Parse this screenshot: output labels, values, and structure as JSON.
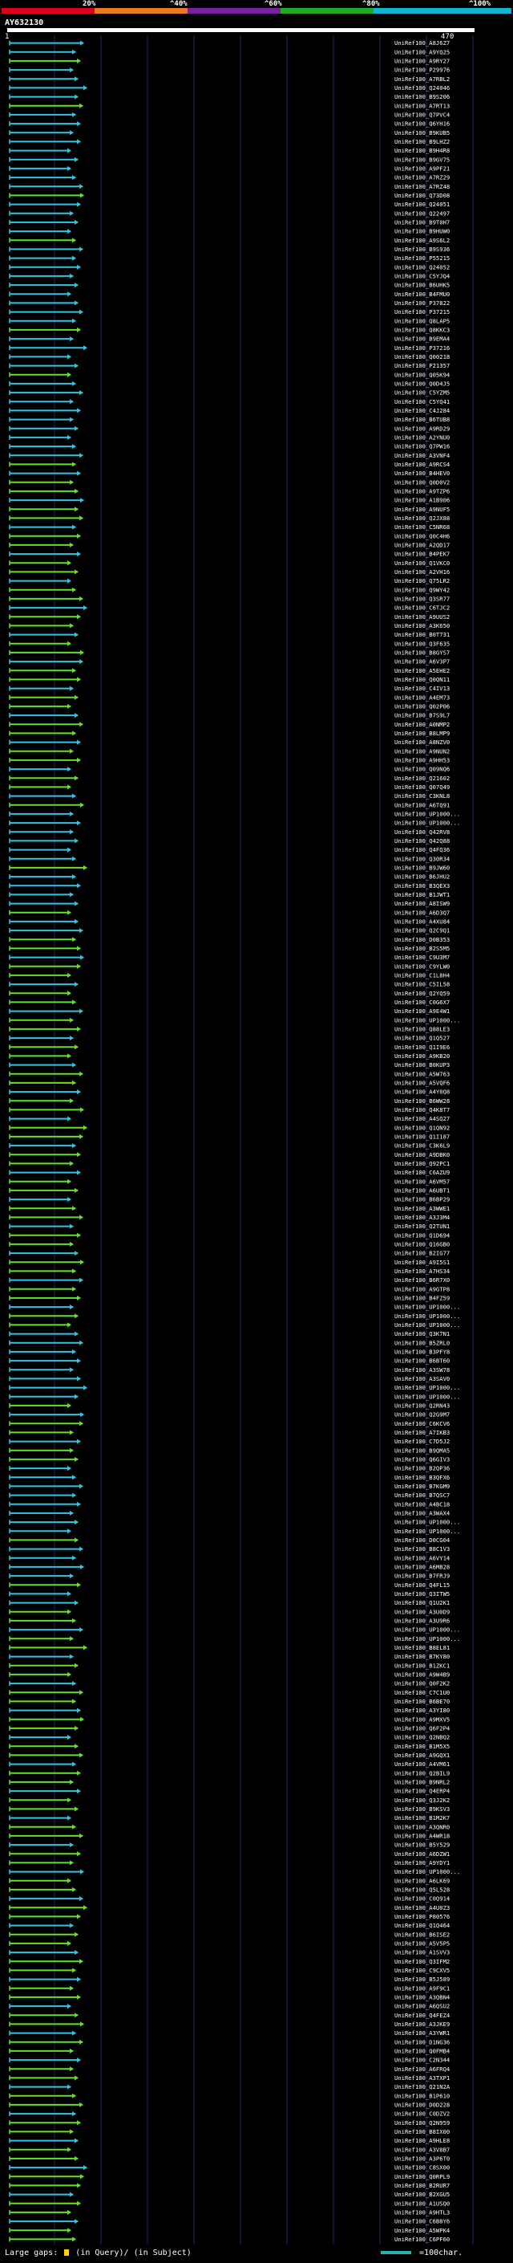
{
  "query": {
    "name": "AY632130",
    "start": "1",
    "end": "470"
  },
  "scale": {
    "labels": [
      "20%",
      "^40%",
      "^60%",
      "^80%",
      "^100%"
    ],
    "colors": [
      "#e0001a",
      "#e67a1c",
      "#7b1fa2",
      "#22aa22",
      "#10b5d6"
    ]
  },
  "colors": {
    "cyan": "#35c3e3",
    "green": "#66e02c",
    "grid_blue": "#1a2a66",
    "bg": "#000000"
  },
  "legend": {
    "left_text": "Large gaps:",
    "left_text2": "(in Query)/",
    "left_text3": "(in Subject)",
    "right_text": "=100char."
  },
  "hits": [
    "UniRef100_A8J6Z7",
    "UniRef100_A9YQ25",
    "UniRef100_A9RY27",
    "UniRef100_P29976",
    "UniRef100_A7RBL2",
    "UniRef100_Q24046",
    "UniRef100_B9S206",
    "UniRef100_A7RT13",
    "UniRef100_Q7PVC4",
    "UniRef100_Q6YH16",
    "UniRef100_B9KUB5",
    "UniRef100_B9LHZ2",
    "UniRef100_B9H4R8",
    "UniRef100_B9GV75",
    "UniRef100_A9PF21",
    "UniRef100_A7RZ29",
    "UniRef100_A7RZ48",
    "UniRef100_Q73D08",
    "UniRef100_Q24051",
    "UniRef100_Q22497",
    "UniRef100_B9T0H7",
    "UniRef100_B9HUW0",
    "UniRef100_A9S6L2",
    "UniRef100_B9S936",
    "UniRef100_P55215",
    "UniRef100_Q24052",
    "UniRef100_C5YJQ4",
    "UniRef100_B6UHK5",
    "UniRef100_B4FMU0",
    "UniRef100_P37822",
    "UniRef100_P37215",
    "UniRef100_Q8LAP5",
    "UniRef100_Q8KKC3",
    "UniRef100_B9EMA4",
    "UniRef100_P37216",
    "UniRef100_Q00218",
    "UniRef100_P21357",
    "UniRef100_Q05K94",
    "UniRef100_Q0D4J5",
    "UniRef100_C5YZM5",
    "UniRef100_C5YQ41",
    "UniRef100_C4J284",
    "UniRef100_B6TUB8",
    "UniRef100_A9RD29",
    "UniRef100_A2YNU0",
    "UniRef100_Q7PW16",
    "UniRef100_A3VNF4",
    "UniRef100_A9RCS4",
    "UniRef100_B4HEV0",
    "UniRef100_Q0D0V2",
    "UniRef100_A9TZP6",
    "UniRef100_A1B906",
    "UniRef100_A9NUF5",
    "UniRef100_Q2JX88",
    "UniRef100_C5NR68",
    "UniRef100_Q0C4H6",
    "UniRef100_A2QD17",
    "UniRef100_B4PEK7",
    "UniRef100_Q1VKC0",
    "UniRef100_A2VH16",
    "UniRef100_Q75LR2",
    "UniRef100_Q9WY42",
    "UniRef100_Q3SR77",
    "UniRef100_C6TJC2",
    "UniRef100_A9UUS2",
    "UniRef100_A3K650",
    "UniRef100_B0T731",
    "UniRef100_Q3F635",
    "UniRef100_B8GYS7",
    "UniRef100_A6V3P7",
    "UniRef100_A5EHE2",
    "UniRef100_Q0QN11",
    "UniRef100_C4IV13",
    "UniRef100_A4EM73",
    "UniRef100_Q02P06",
    "UniRef100_B7S9L7",
    "UniRef100_A0NMP2",
    "UniRef100_B8LMP9",
    "UniRef100_A8NZV0",
    "UniRef100_A9NUN2",
    "UniRef100_A9HH53",
    "UniRef100_Q09NQ6",
    "UniRef100_Q21602",
    "UniRef100_Q07Q49",
    "UniRef100_C3KNL8",
    "UniRef100_A6TQ91",
    "UniRef100_UP1000...",
    "UniRef100_UP1000...",
    "UniRef100_Q42RV8",
    "UniRef100_Q42Q88",
    "UniRef100_Q4FQ36",
    "UniRef100_Q30R34",
    "UniRef100_B9JW60",
    "UniRef100_B6JHU2",
    "UniRef100_B3QEX3",
    "UniRef100_B1JWT1",
    "UniRef100_A8ISW9",
    "UniRef100_A6D3Q7",
    "UniRef100_A4XU84",
    "UniRef100_Q2C9Q1",
    "UniRef100_D0B353",
    "UniRef100_B2S5M5",
    "UniRef100_C9U3M7",
    "UniRef100_C9YLW0",
    "UniRef100_C1L8H4",
    "UniRef100_C5IL58",
    "UniRef100_Q2YQ59",
    "UniRef100_C0G6X7",
    "UniRef100_A9E4W1",
    "UniRef100_UP1000...",
    "UniRef100_Q88LE3",
    "UniRef100_Q1Q527",
    "UniRef100_Q1I9E6",
    "UniRef100_A9KB20",
    "UniRef100_B0KUP3",
    "UniRef100_A5W763",
    "UniRef100_A5VQF6",
    "UniRef100_A4Y0Q8",
    "UniRef100_B6WW28",
    "UniRef100_Q4K8T7",
    "UniRef100_A4SQ27",
    "UniRef100_Q1QN92",
    "UniRef100_Q1I187",
    "UniRef100_C3K6L9",
    "UniRef100_A9DBK0",
    "UniRef100_Q92PC1",
    "UniRef100_C6AZU9",
    "UniRef100_A6VM57",
    "UniRef100_A6UBT1",
    "UniRef100_B6BP29",
    "UniRef100_A3WWE1",
    "UniRef100_A3J3M4",
    "UniRef100_Q2TUN1",
    "UniRef100_Q1D694",
    "UniRef100_Q16GB0",
    "UniRef100_B2IG77",
    "UniRef100_A9I5S1",
    "UniRef100_A7HS34",
    "UniRef100_B6R7X0",
    "UniRef100_A9GTP8",
    "UniRef100_B4FZ59",
    "UniRef100_UP1000...",
    "UniRef100_UP1000...",
    "UniRef100_UP1000...",
    "UniRef100_Q3K7N1",
    "UniRef100_B5ZRL0",
    "UniRef100_B3PFY8",
    "UniRef100_B6BT60",
    "UniRef100_A3SW78",
    "UniRef100_A3SAV0",
    "UniRef100_UP1000...",
    "UniRef100_UP1000...",
    "UniRef100_Q2RN43",
    "UniRef100_Q2G9M7",
    "UniRef100_C6KCV6",
    "UniRef100_A7IKB3",
    "UniRef100_C7D5J2",
    "UniRef100_B9QMA5",
    "UniRef100_Q6GIV3",
    "UniRef100_B2QP36",
    "UniRef100_B3QFX6",
    "UniRef100_B7KGM9",
    "UniRef100_B7QSC7",
    "UniRef100_A4BC18",
    "UniRef100_A3WAX4",
    "UniRef100_UP1000...",
    "UniRef100_UP1000...",
    "UniRef100_D0CG04",
    "UniRef100_B8C1V3",
    "UniRef100_A6VY14",
    "UniRef100_A6MB28",
    "UniRef100_B7FRJ9",
    "UniRef100_Q4FL15",
    "UniRef100_Q3ITW5",
    "UniRef100_Q1U2K1",
    "UniRef100_A3U0D9",
    "UniRef100_A3U9R6",
    "UniRef100_UP1000...",
    "UniRef100_UP1000...",
    "UniRef100_B8EL81",
    "UniRef100_B7KY80",
    "UniRef100_B1ZKC1",
    "UniRef100_A9W4B9",
    "UniRef100_Q0F2K2",
    "UniRef100_C7C1U0",
    "UniRef100_B6BE70",
    "UniRef100_A3YI80",
    "UniRef100_A9MXV5",
    "UniRef100_Q6F2P4",
    "UniRef100_Q2NBQ2",
    "UniRef100_B1M5X5",
    "UniRef100_A9GQX1",
    "UniRef100_A4VM61",
    "UniRef100_Q2BIL9",
    "UniRef100_B9NRL2",
    "UniRef100_Q4ERP4",
    "UniRef100_Q3J2K2",
    "UniRef100_B9KSV3",
    "UniRef100_B1M2K7",
    "UniRef100_A3QNR0",
    "UniRef100_A4WR18",
    "UniRef100_B5Y529",
    "UniRef100_A6DZW1",
    "UniRef100_A9YDY1",
    "UniRef100_UP1000...",
    "UniRef100_A6LK69",
    "UniRef100_Q5L528",
    "UniRef100_C0Q914",
    "UniRef100_A4U0Z3",
    "UniRef100_P80576",
    "UniRef100_Q1Q464",
    "UniRef100_B6ISE2",
    "UniRef100_A5V5P5",
    "UniRef100_A1SVV3",
    "UniRef100_Q3IFM2",
    "UniRef100_C9CXV5",
    "UniRef100_B5J589",
    "UniRef100_A9F9C1",
    "UniRef100_A3QBN4",
    "UniRef100_A6QSU2",
    "UniRef100_Q4FEZ4",
    "UniRef100_A3JKE9",
    "UniRef100_A3YWR1",
    "UniRef100_D1NG36",
    "UniRef100_Q0FMB4",
    "UniRef100_C2N344",
    "UniRef100_A6FRQ4",
    "UniRef100_A3TXP1",
    "UniRef100_Q21N2A",
    "UniRef100_B1P610",
    "UniRef100_D0D228",
    "UniRef100_C0DZV2",
    "UniRef100_Q2N959",
    "UniRef100_B8IX00",
    "UniRef100_A9HLE8",
    "UniRef100_A3V8B7",
    "UniRef100_A3P6T0",
    "UniRef100_C8SX00",
    "UniRef100_Q0RPL9",
    "UniRef100_B2RUR7",
    "UniRef100_B2XGU5",
    "UniRef100_A1USQ0",
    "UniRef100_A9HTL3",
    "UniRef100_C6B8Y6",
    "UniRef100_A5WPK4",
    "UniRef100_C6PF60"
  ]
}
